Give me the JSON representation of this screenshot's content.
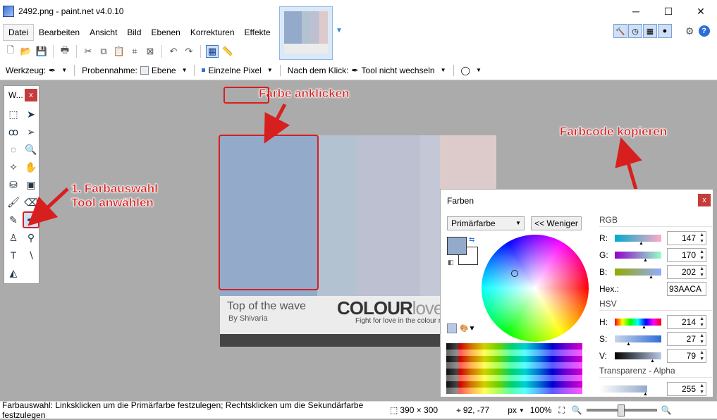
{
  "window": {
    "title": "2492.png - paint.net v4.0.10",
    "controls": {
      "minimize": "─",
      "maximize": "☐",
      "close": "✕"
    }
  },
  "menu": [
    "Datei",
    "Bearbeiten",
    "Ansicht",
    "Bild",
    "Ebenen",
    "Korrekturen",
    "Effekte"
  ],
  "tool_options": {
    "werkzeug_label": "Werkzeug:",
    "probennahme_label": "Probennahme:",
    "probennahme_value": "Ebene",
    "sampling_value": "Einzelne Pixel",
    "nach_klick_label": "Nach dem Klick:",
    "nach_klick_value": "Tool nicht wechseln"
  },
  "tools_window": {
    "title": "W...",
    "close": "x"
  },
  "image": {
    "caption": "Top of the wave",
    "author": "By Shivaria",
    "brand_bold": "COLOUR",
    "brand_light": "lovers",
    "slogan": "Fight for love in the colour revolution",
    "strips": [
      "#93aaca",
      "#b3c2d1",
      "#bcc0d1",
      "#c4c7d6",
      "#ddcbcb"
    ]
  },
  "annotations": {
    "farbe_anklicken": "Farbe anklicken",
    "farbauswahl_line1": "1. Farbauswahl",
    "farbauswahl_line2": "Tool anwählen",
    "farbcode_kopieren": "Farbcode kopieren"
  },
  "colors_panel": {
    "title": "Farben",
    "close": "x",
    "primary_select": "Primärfarbe",
    "less_button": "<< Weniger",
    "rgb_label": "RGB",
    "r_label": "R:",
    "r_value": "147",
    "g_label": "G:",
    "g_value": "170",
    "b_label": "B:",
    "b_value": "202",
    "hex_label": "Hex.:",
    "hex_value": "93AACA",
    "hsv_label": "HSV",
    "h_label": "H:",
    "h_value": "214",
    "s_label": "S:",
    "s_value": "27",
    "v_label": "V:",
    "v_value": "79",
    "alpha_label": "Transparenz - Alpha",
    "alpha_value": "255",
    "primary_color": "#93aaca",
    "secondary_color": "#ffffff"
  },
  "statusbar": {
    "message": "Farbauswahl: Linksklicken um die Primärfarbe festzulegen; Rechtsklicken um die Sekundärfarbe festzulegen",
    "image_size": "390 × 300",
    "cursor_pos": "92, -77",
    "unit": "px",
    "zoom": "100%"
  },
  "accent_color": "#d81f1f"
}
